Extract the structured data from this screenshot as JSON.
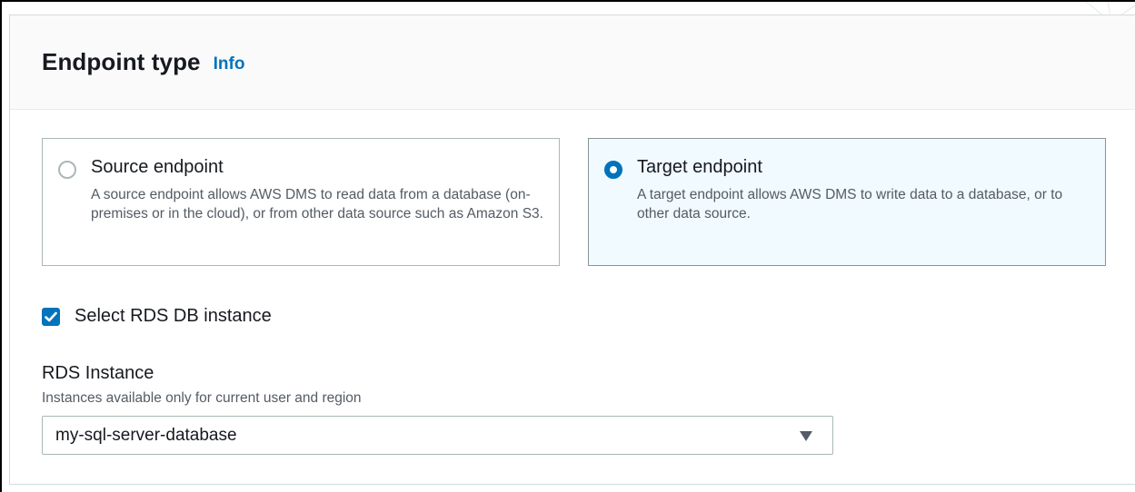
{
  "panel": {
    "title": "Endpoint type",
    "info_link": "Info"
  },
  "endpoint_options": [
    {
      "label": "Source endpoint",
      "description": "A source endpoint allows AWS DMS to read data from a database (on-premises or in the cloud), or from other data source such as Amazon S3.",
      "selected": false
    },
    {
      "label": "Target endpoint",
      "description": "A target endpoint allows AWS DMS to write data to a database, or to other data source.",
      "selected": true
    }
  ],
  "rds_checkbox": {
    "label": "Select RDS DB instance",
    "checked": true,
    "icon": "checkmark-icon"
  },
  "rds_instance": {
    "label": "RDS Instance",
    "description": "Instances available only for current user and region",
    "selected_value": "my-sql-server-database",
    "icon": "caret-down-icon"
  },
  "colors": {
    "accent": "#0073bb",
    "selected_tile_bg": "#f1faff",
    "text": "#16191f",
    "secondary_text": "#545b64",
    "border": "#aab7b8"
  }
}
